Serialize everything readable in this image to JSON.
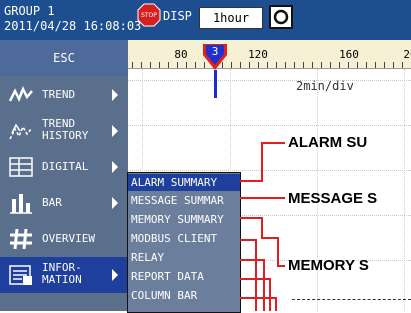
{
  "status_bar": {
    "group": "GROUP 1",
    "datetime": "2011/04/28 16:08:03",
    "disp_label": "DISP",
    "time_button": "1hour"
  },
  "scale": {
    "tick_labels": [
      "80",
      "120",
      "160",
      "20"
    ],
    "marker_number": "3"
  },
  "chart": {
    "time_scale": "2min/div"
  },
  "menu": {
    "esc": "ESC",
    "items": [
      {
        "label": "TREND",
        "icon": "trend-icon"
      },
      {
        "label": "TREND\nHISTORY",
        "icon": "trend-history-icon"
      },
      {
        "label": "DIGITAL",
        "icon": "digital-icon"
      },
      {
        "label": "BAR",
        "icon": "bar-icon"
      },
      {
        "label": "OVERVIEW",
        "icon": "overview-icon"
      },
      {
        "label": "INFOR-\nMATION",
        "icon": "information-icon"
      }
    ]
  },
  "submenu": {
    "items": [
      "ALARM SUMMARY",
      "MESSAGE SUMMAR",
      "MEMORY SUMMARY",
      "MODBUS CLIENT",
      "RELAY",
      "REPORT DATA",
      "COLUMN BAR"
    ]
  },
  "callouts": [
    "ALARM SU",
    "MESSAGE S",
    "MEMORY S"
  ],
  "colors": {
    "status_bar": "#1d4e8f",
    "menu_bg": "#5a6f8c",
    "active": "#1f3f9c",
    "callout_line": "#e02020",
    "scale_bg": "#f6f1d4"
  }
}
